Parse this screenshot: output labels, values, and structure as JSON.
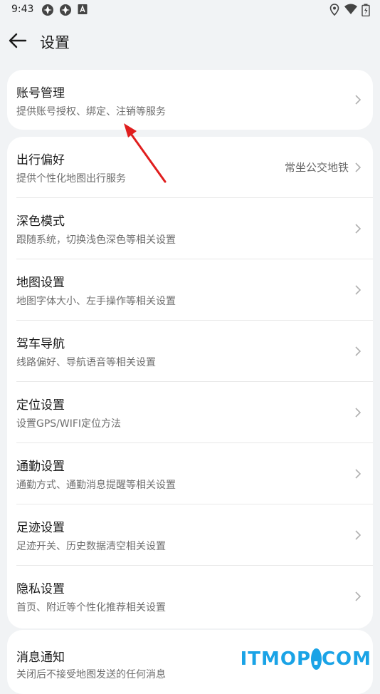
{
  "status_bar": {
    "time": "9:43",
    "left_icons": [
      "app-icon",
      "app-icon",
      "a-box-icon"
    ],
    "right_icons": [
      "location-icon",
      "wifi-icon",
      "battery-icon"
    ]
  },
  "header": {
    "title": "设置",
    "back_icon": "back-arrow-icon"
  },
  "account": {
    "label": "账号管理",
    "sub": "提供账号授权、绑定、注销等服务"
  },
  "settings": [
    {
      "label": "出行偏好",
      "sub": "提供个性化地图出行服务",
      "value": "常坐公交地铁"
    },
    {
      "label": "深色模式",
      "sub": "跟随系统，切换浅色深色等相关设置"
    },
    {
      "label": "地图设置",
      "sub": "地图字体大小、左手操作等相关设置"
    },
    {
      "label": "驾车导航",
      "sub": "线路偏好、导航语音等相关设置"
    },
    {
      "label": "定位设置",
      "sub": "设置GPS/WIFI定位方法"
    },
    {
      "label": "通勤设置",
      "sub": "通勤方式、通勤消息提醒等相关设置"
    },
    {
      "label": "足迹设置",
      "sub": "足迹开关、历史数据清空相关设置"
    },
    {
      "label": "隐私设置",
      "sub": "首页、附近等个性化推荐相关设置"
    }
  ],
  "notifications": {
    "label": "消息通知",
    "sub": "关闭后不接受地图发送的任何消息"
  },
  "watermark": {
    "part1": "ITMOP",
    "part2": ".",
    "part3": "COM"
  },
  "colors": {
    "background": "#f1f3f5",
    "card": "#ffffff",
    "annotation_arrow": "#e01e1e",
    "watermark": "#1aa3e6"
  }
}
